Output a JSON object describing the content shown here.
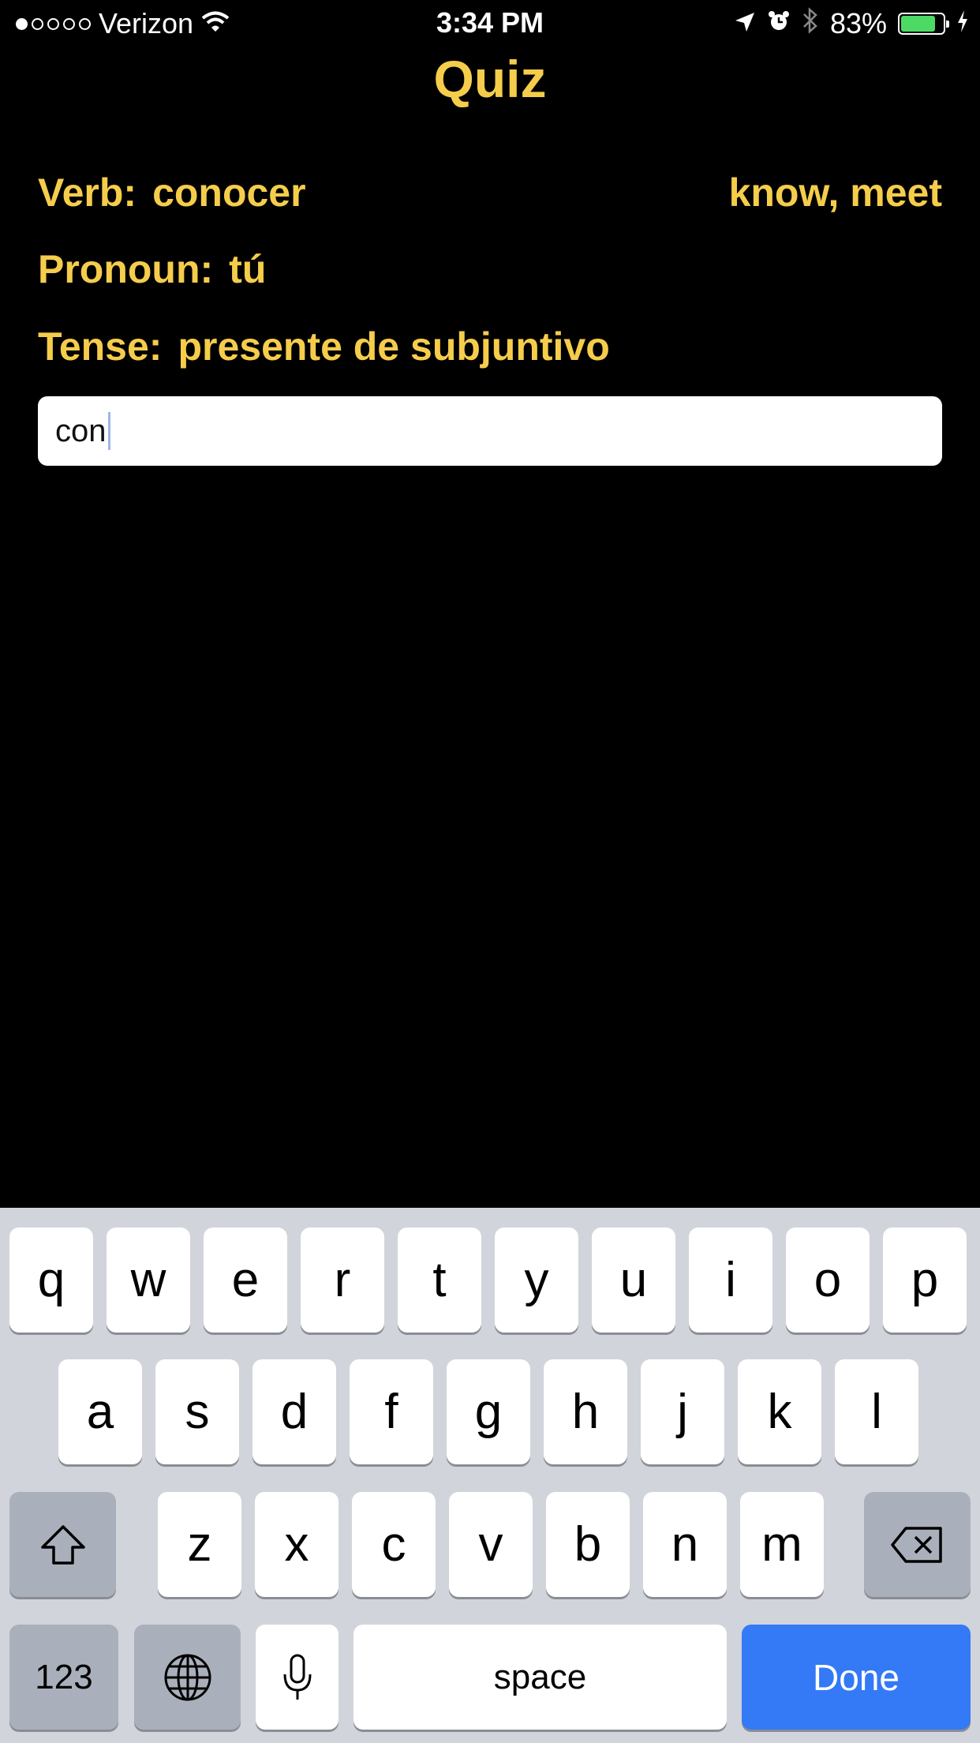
{
  "status_bar": {
    "carrier": "Verizon",
    "signal_bars": 1,
    "signal_total": 5,
    "time": "3:34 PM",
    "battery_percent": "83%",
    "battery_level": 0.83,
    "icons": [
      "wifi-icon",
      "location-icon",
      "alarm-icon",
      "bluetooth-icon",
      "battery-icon",
      "charging-icon"
    ]
  },
  "header": {
    "title": "Quiz"
  },
  "quiz": {
    "verb_label": "Verb:",
    "verb_value": "conocer",
    "translation": "know, meet",
    "pronoun_label": "Pronoun:",
    "pronoun_value": "tú",
    "tense_label": "Tense:",
    "tense_value": "presente de subjuntivo",
    "answer_value": "con"
  },
  "keyboard": {
    "row1": [
      "q",
      "w",
      "e",
      "r",
      "t",
      "y",
      "u",
      "i",
      "o",
      "p"
    ],
    "row2": [
      "a",
      "s",
      "d",
      "f",
      "g",
      "h",
      "j",
      "k",
      "l"
    ],
    "row3": [
      "z",
      "x",
      "c",
      "v",
      "b",
      "n",
      "m"
    ],
    "numbers_label": "123",
    "space_label": "space",
    "done_label": "Done",
    "done_color": "#3479f6"
  },
  "colors": {
    "accent": "#f5cd4b",
    "background": "#000000",
    "keyboard_bg": "#d1d4db"
  }
}
